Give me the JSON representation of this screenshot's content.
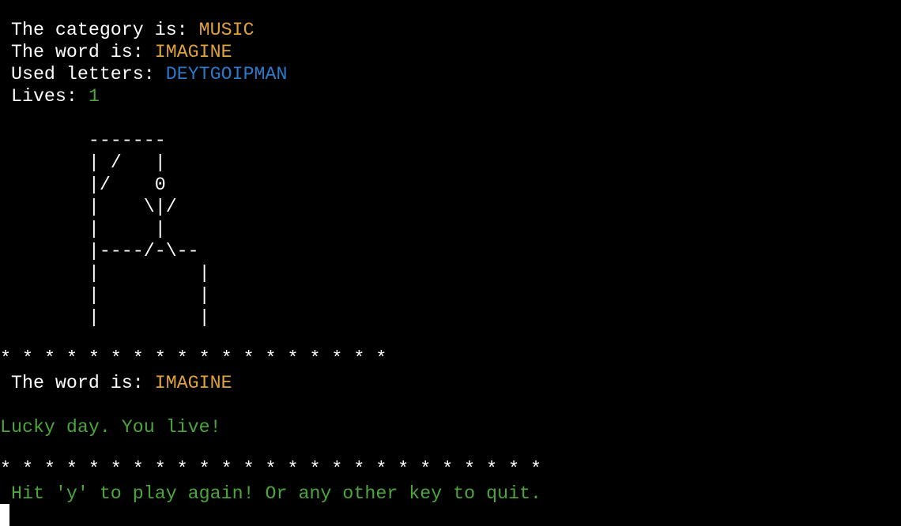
{
  "status": {
    "category_label": " The category is: ",
    "category_value": "MUSIC",
    "word_label": " The word is: ",
    "word_value": "IMAGINE",
    "used_label": " Used letters: ",
    "used_value": "DEYTGOIPMAN",
    "lives_label": " Lives: ",
    "lives_value": "1"
  },
  "gallows": [
    "        -------",
    "        | /   |",
    "        |/    0",
    "        |    \\|/",
    "        |     |",
    "        |----/-\\--",
    "        |         |",
    "        |         |",
    "        |         |"
  ],
  "result": {
    "separator_1": "* * * * * * * * * * * * * * * * * *",
    "word_label": " The word is: ",
    "word_value": "IMAGINE",
    "message": "Lucky day. You live!",
    "separator_2": "* * * * * * * * * * * * * * * * * * * * * * * * *",
    "prompt": " Hit 'y' to play again! Or any other key to quit."
  },
  "colors": {
    "background": "#000000",
    "text": "#ffffff",
    "value_highlight": "#e0a23a",
    "used_letters": "#2a79c9",
    "success": "#4ca63b"
  }
}
